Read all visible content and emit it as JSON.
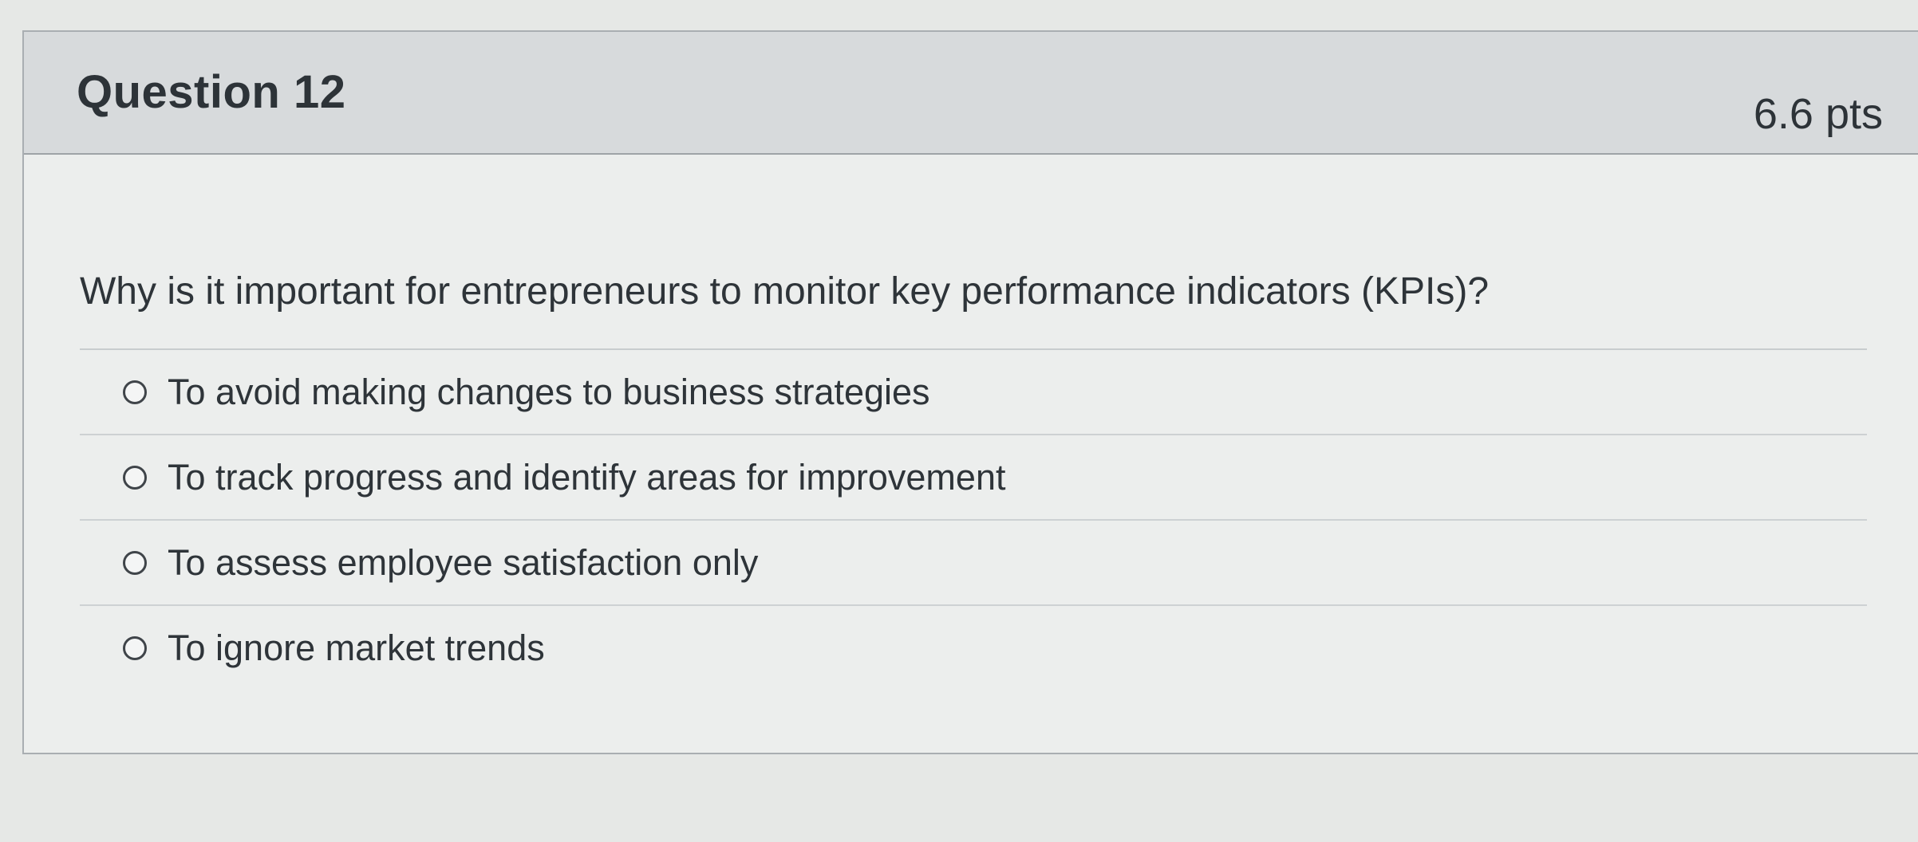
{
  "question": {
    "title": "Question 12",
    "points": "6.6 pts",
    "prompt": "Why is it important for entrepreneurs to monitor key performance indicators (KPIs)?",
    "answers": [
      {
        "label": "To avoid making changes to business strategies"
      },
      {
        "label": "To track progress and identify areas for improvement"
      },
      {
        "label": "To assess employee satisfaction only"
      },
      {
        "label": "To ignore market trends"
      }
    ]
  }
}
